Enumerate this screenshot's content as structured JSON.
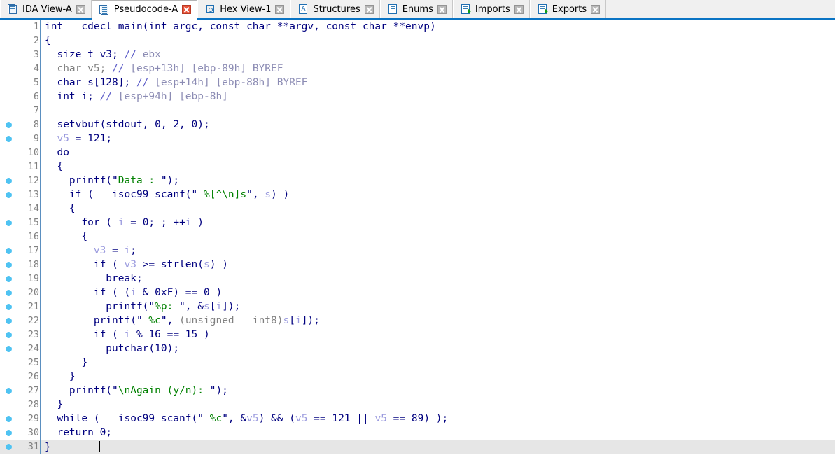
{
  "tabs": [
    {
      "label": "IDA View-A",
      "icon": "doc-pages-icon",
      "active": false,
      "close_style": "gray"
    },
    {
      "label": "Pseudocode-A",
      "icon": "doc-pages-icon",
      "active": true,
      "close_style": "red"
    },
    {
      "label": "Hex View-1",
      "icon": "hex-circle-icon",
      "active": false,
      "close_style": "gray"
    },
    {
      "label": "Structures",
      "icon": "letter-a-icon",
      "active": false,
      "close_style": "gray"
    },
    {
      "label": "Enums",
      "icon": "list-icon",
      "active": false,
      "close_style": "gray"
    },
    {
      "label": "Imports",
      "icon": "import-icon",
      "active": false,
      "close_style": "gray"
    },
    {
      "label": "Exports",
      "icon": "export-icon",
      "active": false,
      "close_style": "gray"
    }
  ],
  "colors": {
    "keyword": "#00007f",
    "string": "#008000",
    "comment": "#8c8cb4",
    "comment_marker": "#5c5cc8",
    "local_var": "#9a9ade",
    "grayed_out": "#808080",
    "line_number": "#808080",
    "breakpoint_dot": "#4fc3f2",
    "tab_underline": "#0a74c4",
    "current_line_bg": "#e6e6e6"
  },
  "editor": {
    "current_line": 31,
    "cursor_column": 9,
    "total_lines": 31
  },
  "code_lines": [
    {
      "n": 1,
      "bp": false,
      "tokens": [
        {
          "t": "plain",
          "v": "int __cdecl main(int argc, const char **argv, const char **envp)"
        }
      ]
    },
    {
      "n": 2,
      "bp": false,
      "tokens": [
        {
          "t": "plain",
          "v": "{"
        }
      ]
    },
    {
      "n": 3,
      "bp": false,
      "tokens": [
        {
          "t": "plain",
          "v": "  size_t v3; "
        },
        {
          "t": "cmtmk",
          "v": "// "
        },
        {
          "t": "cmt",
          "v": "ebx"
        }
      ]
    },
    {
      "n": 4,
      "bp": false,
      "tokens": [
        {
          "t": "gray",
          "v": "  char v5; "
        },
        {
          "t": "cmtmk",
          "v": "// "
        },
        {
          "t": "cmt",
          "v": "[esp+13h] [ebp-89h] BYREF"
        }
      ]
    },
    {
      "n": 5,
      "bp": false,
      "tokens": [
        {
          "t": "plain",
          "v": "  char s[128]; "
        },
        {
          "t": "cmtmk",
          "v": "// "
        },
        {
          "t": "cmt",
          "v": "[esp+14h] [ebp-88h] BYREF"
        }
      ]
    },
    {
      "n": 6,
      "bp": false,
      "tokens": [
        {
          "t": "plain",
          "v": "  int i; "
        },
        {
          "t": "cmtmk",
          "v": "// "
        },
        {
          "t": "cmt",
          "v": "[esp+94h] [ebp-8h]"
        }
      ]
    },
    {
      "n": 7,
      "bp": false,
      "tokens": [
        {
          "t": "plain",
          "v": ""
        }
      ]
    },
    {
      "n": 8,
      "bp": true,
      "tokens": [
        {
          "t": "plain",
          "v": "  setvbuf(stdout, 0, 2, 0);"
        }
      ]
    },
    {
      "n": 9,
      "bp": true,
      "tokens": [
        {
          "t": "plain",
          "v": "  "
        },
        {
          "t": "var",
          "v": "v5"
        },
        {
          "t": "plain",
          "v": " = 121;"
        }
      ]
    },
    {
      "n": 10,
      "bp": false,
      "tokens": [
        {
          "t": "plain",
          "v": "  do"
        }
      ]
    },
    {
      "n": 11,
      "bp": false,
      "tokens": [
        {
          "t": "plain",
          "v": "  {"
        }
      ]
    },
    {
      "n": 12,
      "bp": true,
      "tokens": [
        {
          "t": "plain",
          "v": "    printf("
        },
        {
          "t": "quote",
          "v": "\""
        },
        {
          "t": "str",
          "v": "Data : "
        },
        {
          "t": "quote",
          "v": "\""
        },
        {
          "t": "plain",
          "v": ");"
        }
      ]
    },
    {
      "n": 13,
      "bp": true,
      "tokens": [
        {
          "t": "plain",
          "v": "    if ( __isoc99_scanf("
        },
        {
          "t": "quote",
          "v": "\""
        },
        {
          "t": "str",
          "v": " %[^\\n]s"
        },
        {
          "t": "quote",
          "v": "\""
        },
        {
          "t": "plain",
          "v": ", "
        },
        {
          "t": "var",
          "v": "s"
        },
        {
          "t": "plain",
          "v": ") )"
        }
      ]
    },
    {
      "n": 14,
      "bp": false,
      "tokens": [
        {
          "t": "plain",
          "v": "    {"
        }
      ]
    },
    {
      "n": 15,
      "bp": true,
      "tokens": [
        {
          "t": "plain",
          "v": "      for ( "
        },
        {
          "t": "var",
          "v": "i"
        },
        {
          "t": "plain",
          "v": " = 0; ; ++"
        },
        {
          "t": "var",
          "v": "i"
        },
        {
          "t": "plain",
          "v": " )"
        }
      ]
    },
    {
      "n": 16,
      "bp": false,
      "tokens": [
        {
          "t": "plain",
          "v": "      {"
        }
      ]
    },
    {
      "n": 17,
      "bp": true,
      "tokens": [
        {
          "t": "plain",
          "v": "        "
        },
        {
          "t": "var",
          "v": "v3"
        },
        {
          "t": "plain",
          "v": " = "
        },
        {
          "t": "var",
          "v": "i"
        },
        {
          "t": "plain",
          "v": ";"
        }
      ]
    },
    {
      "n": 18,
      "bp": true,
      "tokens": [
        {
          "t": "plain",
          "v": "        if ( "
        },
        {
          "t": "var",
          "v": "v3"
        },
        {
          "t": "plain",
          "v": " >= strlen("
        },
        {
          "t": "var",
          "v": "s"
        },
        {
          "t": "plain",
          "v": ") )"
        }
      ]
    },
    {
      "n": 19,
      "bp": true,
      "tokens": [
        {
          "t": "plain",
          "v": "          break;"
        }
      ]
    },
    {
      "n": 20,
      "bp": true,
      "tokens": [
        {
          "t": "plain",
          "v": "        if ( ("
        },
        {
          "t": "var",
          "v": "i"
        },
        {
          "t": "plain",
          "v": " & 0xF) == 0 )"
        }
      ]
    },
    {
      "n": 21,
      "bp": true,
      "tokens": [
        {
          "t": "plain",
          "v": "          printf("
        },
        {
          "t": "quote",
          "v": "\""
        },
        {
          "t": "str",
          "v": "%p: "
        },
        {
          "t": "quote",
          "v": "\""
        },
        {
          "t": "plain",
          "v": ", &"
        },
        {
          "t": "var",
          "v": "s"
        },
        {
          "t": "plain",
          "v": "["
        },
        {
          "t": "var",
          "v": "i"
        },
        {
          "t": "plain",
          "v": "]);"
        }
      ]
    },
    {
      "n": 22,
      "bp": true,
      "tokens": [
        {
          "t": "plain",
          "v": "        printf("
        },
        {
          "t": "quote",
          "v": "\""
        },
        {
          "t": "str",
          "v": " %c"
        },
        {
          "t": "quote",
          "v": "\""
        },
        {
          "t": "plain",
          "v": ", "
        },
        {
          "t": "gray",
          "v": "(unsigned __int8)"
        },
        {
          "t": "var",
          "v": "s"
        },
        {
          "t": "plain",
          "v": "["
        },
        {
          "t": "var",
          "v": "i"
        },
        {
          "t": "plain",
          "v": "]);"
        }
      ]
    },
    {
      "n": 23,
      "bp": true,
      "tokens": [
        {
          "t": "plain",
          "v": "        if ( "
        },
        {
          "t": "var",
          "v": "i"
        },
        {
          "t": "plain",
          "v": " % 16 == 15 )"
        }
      ]
    },
    {
      "n": 24,
      "bp": true,
      "tokens": [
        {
          "t": "plain",
          "v": "          putchar(10);"
        }
      ]
    },
    {
      "n": 25,
      "bp": false,
      "tokens": [
        {
          "t": "plain",
          "v": "      }"
        }
      ]
    },
    {
      "n": 26,
      "bp": false,
      "tokens": [
        {
          "t": "plain",
          "v": "    }"
        }
      ]
    },
    {
      "n": 27,
      "bp": true,
      "tokens": [
        {
          "t": "plain",
          "v": "    printf("
        },
        {
          "t": "quote",
          "v": "\""
        },
        {
          "t": "str",
          "v": "\\nAgain (y/n): "
        },
        {
          "t": "quote",
          "v": "\""
        },
        {
          "t": "plain",
          "v": ");"
        }
      ]
    },
    {
      "n": 28,
      "bp": false,
      "tokens": [
        {
          "t": "plain",
          "v": "  }"
        }
      ]
    },
    {
      "n": 29,
      "bp": true,
      "tokens": [
        {
          "t": "plain",
          "v": "  while ( __isoc99_scanf("
        },
        {
          "t": "quote",
          "v": "\""
        },
        {
          "t": "str",
          "v": " %c"
        },
        {
          "t": "quote",
          "v": "\""
        },
        {
          "t": "plain",
          "v": ", &"
        },
        {
          "t": "var",
          "v": "v5"
        },
        {
          "t": "plain",
          "v": ") && ("
        },
        {
          "t": "var",
          "v": "v5"
        },
        {
          "t": "plain",
          "v": " == 121 || "
        },
        {
          "t": "var",
          "v": "v5"
        },
        {
          "t": "plain",
          "v": " == 89) );"
        }
      ]
    },
    {
      "n": 30,
      "bp": true,
      "tokens": [
        {
          "t": "plain",
          "v": "  return 0;"
        }
      ]
    },
    {
      "n": 31,
      "bp": true,
      "tokens": [
        {
          "t": "plain",
          "v": "}"
        }
      ],
      "current": true,
      "caret_after": "        "
    }
  ]
}
